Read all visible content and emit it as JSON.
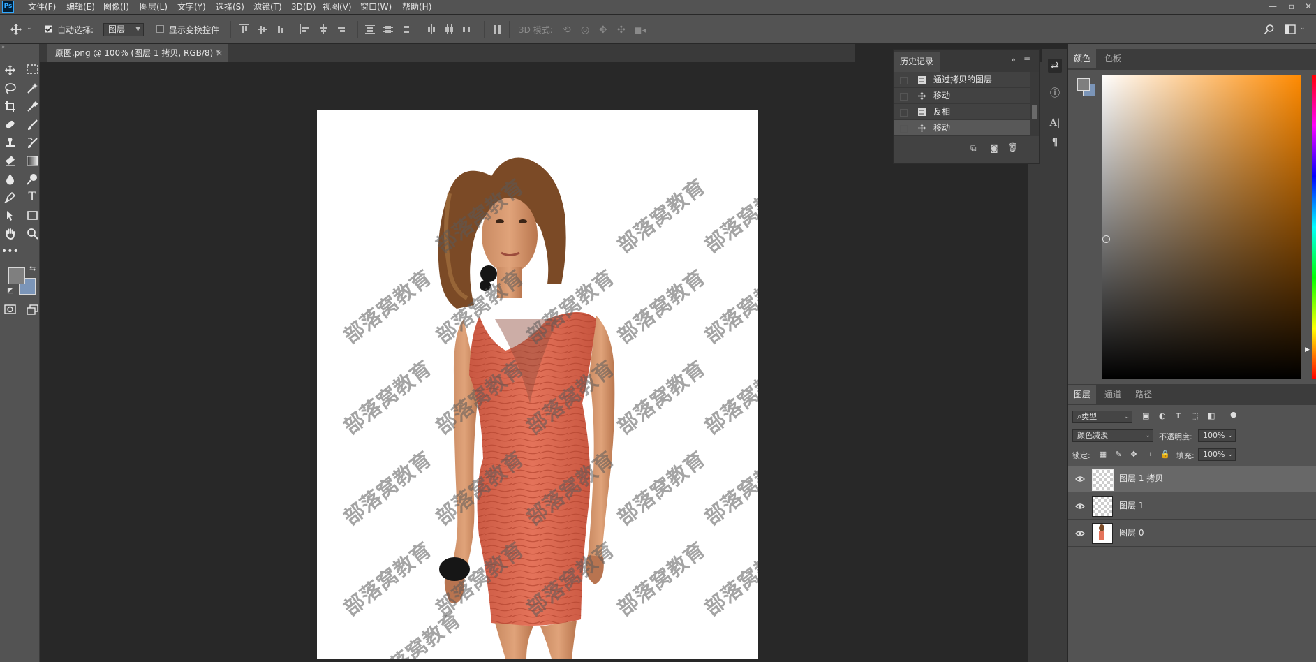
{
  "app": {
    "logo": "Ps"
  },
  "menu": [
    "文件(F)",
    "编辑(E)",
    "图像(I)",
    "图层(L)",
    "文字(Y)",
    "选择(S)",
    "滤镜(T)",
    "3D(D)",
    "视图(V)",
    "窗口(W)",
    "帮助(H)"
  ],
  "window_controls": [
    "—",
    "▫",
    "✕"
  ],
  "options": {
    "auto_select_label": "自动选择:",
    "auto_select_checked": true,
    "target_value": "图层",
    "show_transform_label": "显示变换控件",
    "show_transform_checked": false,
    "mode_3d_label": "3D 模式:"
  },
  "document": {
    "tab_title": "原图.png @ 100% (图层 1 拷贝, RGB/8) *",
    "close_glyph": "×",
    "watermark_text": "部落窝教育"
  },
  "history": {
    "title": "历史记录",
    "items": [
      {
        "label": "通过拷贝的图层",
        "icon": "document-icon"
      },
      {
        "label": "移动",
        "icon": "move-icon"
      },
      {
        "label": "反相",
        "icon": "document-icon"
      },
      {
        "label": "移动",
        "icon": "move-icon",
        "selected": true
      }
    ]
  },
  "color_panel": {
    "tabs": [
      "颜色",
      "色板"
    ],
    "foreground": "#7f7f7f",
    "background": "#7b95b8"
  },
  "layers_panel": {
    "tabs": [
      "图层",
      "通道",
      "路径"
    ],
    "filter_kind": "类型",
    "blend_mode": "颜色减淡",
    "opacity_label": "不透明度:",
    "opacity_value": "100%",
    "lock_label": "锁定:",
    "fill_label": "填充:",
    "fill_value": "100%",
    "layers": [
      {
        "name": "图层 1 拷贝",
        "selected": true
      },
      {
        "name": "图层 1",
        "selected": false
      },
      {
        "name": "图层 0",
        "selected": false
      }
    ]
  }
}
